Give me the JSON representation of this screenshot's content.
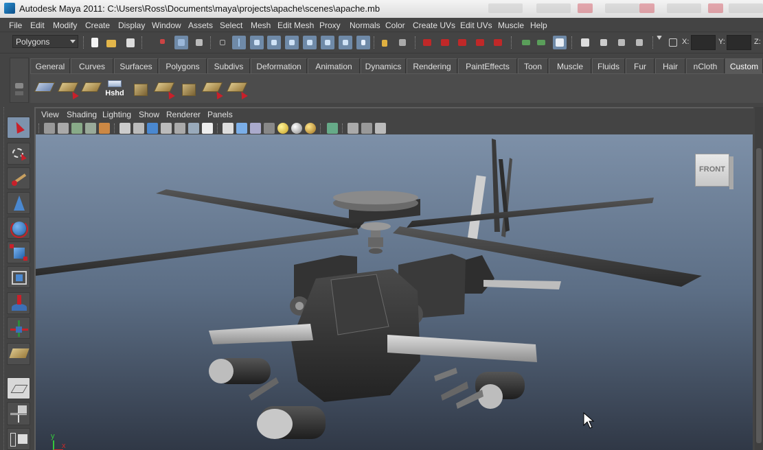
{
  "window": {
    "title": "Autodesk Maya 2011: C:\\Users\\Ross\\Documents\\maya\\projects\\apache\\scenes\\apache.mb"
  },
  "menubar": [
    "File",
    "Edit",
    "Modify",
    "Create",
    "Display",
    "Window",
    "Assets",
    "Select",
    "Mesh",
    "Edit Mesh",
    "Proxy",
    "Normals",
    "Color",
    "Create UVs",
    "Edit UVs",
    "Muscle",
    "Help"
  ],
  "status_line": {
    "mode": "Polygons",
    "x_label": "X:",
    "y_label": "Y:",
    "z_label": "Z:",
    "x_value": "",
    "y_value": ""
  },
  "shelf": {
    "tabs": [
      "General",
      "Curves",
      "Surfaces",
      "Polygons",
      "Subdivs",
      "Deformation",
      "Animation",
      "Dynamics",
      "Rendering",
      "PaintEffects",
      "Toon",
      "Muscle",
      "Fluids",
      "Fur",
      "Hair",
      "nCloth",
      "Custom"
    ],
    "active_tab": "Custom",
    "hshd_label": "Hshd"
  },
  "viewport": {
    "menu": [
      "View",
      "Shading",
      "Lighting",
      "Show",
      "Renderer",
      "Panels"
    ],
    "view_cube_label": "FRONT",
    "axis_y": "y",
    "axis_x": "x",
    "background_top": "#7d90a8",
    "background_bottom": "#303846"
  },
  "colors": {
    "ui_bg": "#444444",
    "active_tool": "#7d93ad",
    "select_cursor_red": "#c8202a"
  }
}
